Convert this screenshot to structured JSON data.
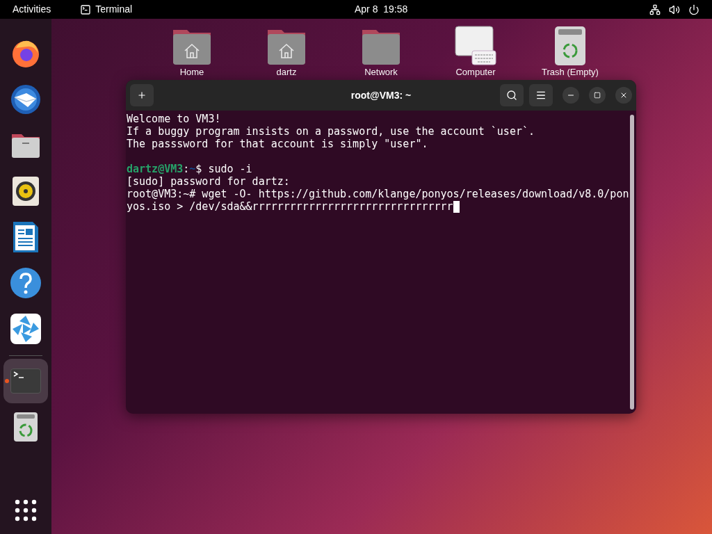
{
  "top_bar": {
    "activities": "Activities",
    "app_name": "Terminal",
    "clock": "Apr 8  19:58"
  },
  "dock": {
    "items": [
      {
        "kind": "firefox",
        "selected": false,
        "running": false
      },
      {
        "kind": "mail",
        "selected": false,
        "running": false
      },
      {
        "kind": "files",
        "selected": false,
        "running": false
      },
      {
        "kind": "music",
        "selected": false,
        "running": false
      },
      {
        "kind": "writer",
        "selected": false,
        "running": false
      },
      {
        "kind": "help",
        "selected": false,
        "running": false
      },
      {
        "kind": "video",
        "selected": false,
        "running": false
      },
      {
        "kind": "terminal",
        "selected": true,
        "running": true
      },
      {
        "kind": "trash",
        "selected": false,
        "running": false
      }
    ]
  },
  "desktop_icons": [
    {
      "kind": "home",
      "label": "Home"
    },
    {
      "kind": "home",
      "label": "dartz"
    },
    {
      "kind": "folder",
      "label": "Network"
    },
    {
      "kind": "computer",
      "label": "Computer"
    },
    {
      "kind": "trash",
      "label": "Trash (Empty)"
    }
  ],
  "terminal": {
    "title": "root@VM3: ~",
    "lines": [
      {
        "kind": "text",
        "text": "Welcome to VM3!"
      },
      {
        "kind": "text",
        "text": "If a buggy program insists on a password, use the account `user`."
      },
      {
        "kind": "text",
        "text": "The passsword for that account is simply \"user\"."
      },
      {
        "kind": "blank"
      },
      {
        "kind": "prompt",
        "user": "dartz@VM3",
        "sep": ":",
        "path": "~",
        "symbol": "$ ",
        "command": "sudo -i"
      },
      {
        "kind": "text",
        "text": "[sudo] password for dartz:"
      },
      {
        "kind": "text",
        "text": "root@VM3:~# wget -O- https://github.com/klange/ponyos/releases/download/v8.0/pon"
      },
      {
        "kind": "input",
        "text": "yos.iso > /dev/sda&&rrrrrrrrrrrrrrrrrrrrrrrrrrrrrrrr",
        "cursor": true
      }
    ]
  }
}
